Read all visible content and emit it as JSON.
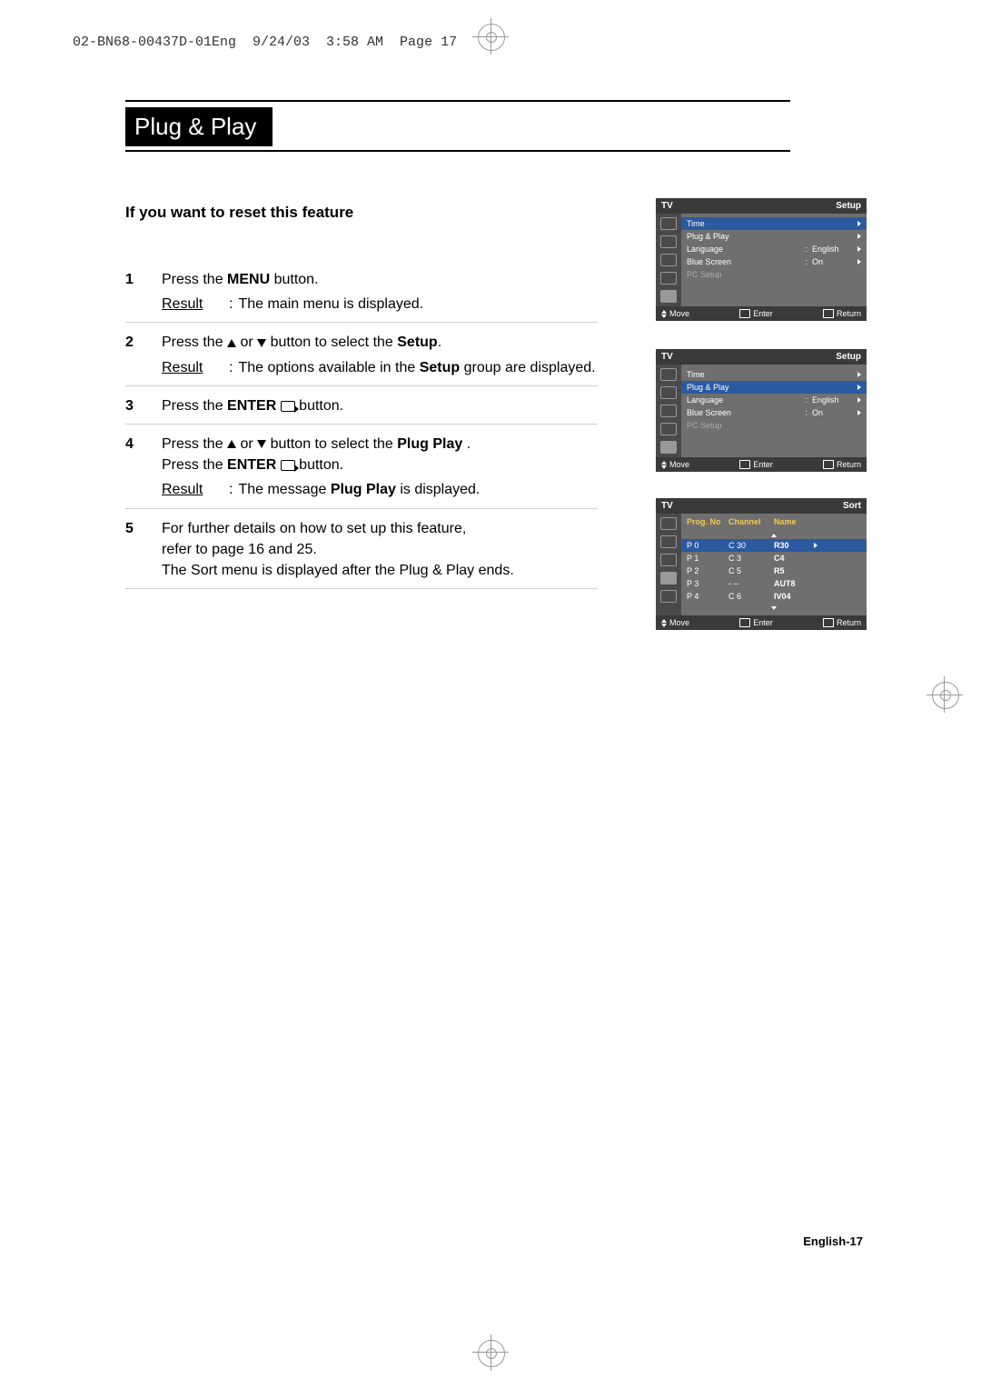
{
  "header_line": "02-BN68-00437D-01Eng  9/24/03  3:58 AM  Page 17",
  "title": "Plug & Play",
  "subhead": "If you want to reset this feature",
  "page_number": "English-17",
  "steps": [
    {
      "num": "1",
      "line1_pre": "Press the ",
      "line1_bold": "MENU",
      "line1_post": " button.",
      "result": "The main menu is displayed."
    },
    {
      "num": "2",
      "line1_pre": "Press the ",
      "line1_post": " button to select the ",
      "line1_bold2": "Setup",
      "line1_end": ".",
      "result_pre": "The options available in the ",
      "result_bold": "Setup",
      "result_post": " group are displayed."
    },
    {
      "num": "3",
      "line1_pre": "Press the ",
      "line1_bold": "ENTER",
      "line1_post": " button."
    },
    {
      "num": "4",
      "line1_pre": "Press the ",
      "line1_post": " button to select the ",
      "line1_bold2": "Plug   Play",
      "line1_end": " .",
      "line2_pre": "Press the ",
      "line2_bold": "ENTER",
      "line2_post": " button.",
      "result_pre": "The message ",
      "result_bold": "Plug   Play",
      "result_post": "    is displayed."
    },
    {
      "num": "5",
      "line1": "For further details on how to set up this feature,",
      "line2": "refer to page 16 and 25.",
      "line3": "The Sort menu is displayed after the Plug & Play ends."
    }
  ],
  "result_label": "Result",
  "or_label": " or ",
  "osd_footer": {
    "move": "Move",
    "enter": "Enter",
    "return": "Return"
  },
  "osd_header": {
    "tv": "TV",
    "setup": "Setup",
    "sort": "Sort"
  },
  "osd_menu": {
    "time": "Time",
    "plug_play": "Plug & Play",
    "language": "Language",
    "language_val": "English",
    "blue_screen": "Blue Screen",
    "blue_screen_val": "On",
    "pc_setup": "PC Setup"
  },
  "sort": {
    "headers": {
      "prog": "Prog. No",
      "channel": "Channel",
      "name": "Name"
    },
    "rows": [
      {
        "prog": "P  0",
        "channel": "C 30",
        "name": "R30",
        "hl": true
      },
      {
        "prog": "P  1",
        "channel": "C   3",
        "name": "C4"
      },
      {
        "prog": "P  2",
        "channel": "C   5",
        "name": "R5"
      },
      {
        "prog": "P  3",
        "channel": "-  --",
        "name": "AUT8"
      },
      {
        "prog": "P  4",
        "channel": "C   6",
        "name": "IV04"
      }
    ]
  }
}
